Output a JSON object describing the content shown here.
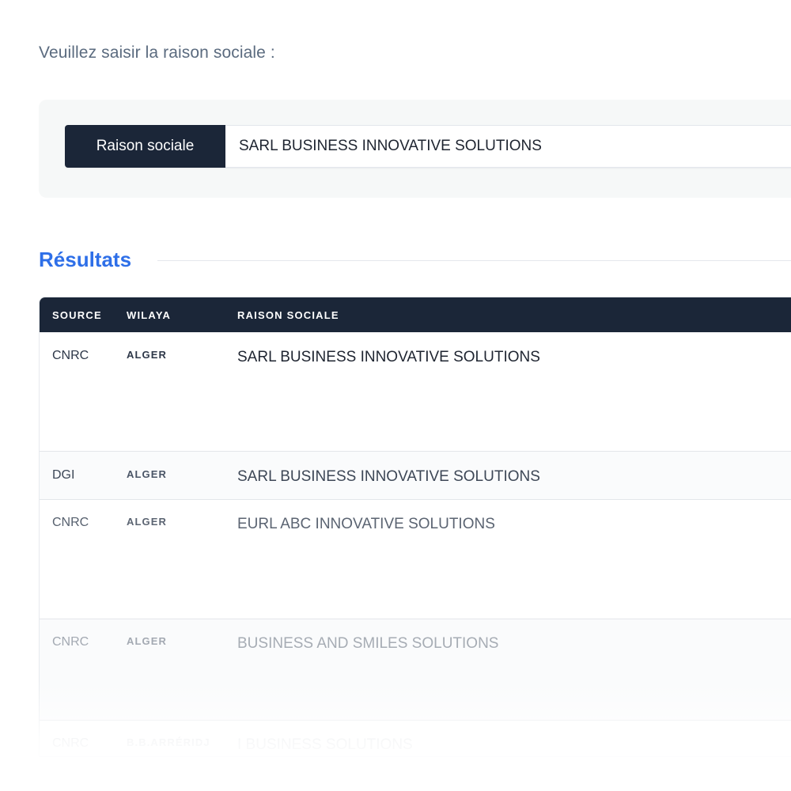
{
  "prompt": "Veuillez saisir la raison sociale :",
  "search": {
    "addon_label": "Raison sociale",
    "value": "SARL BUSINESS INNOVATIVE SOLUTIONS"
  },
  "results": {
    "title": "Résultats",
    "columns": [
      "SOURCE",
      "WILAYA",
      "RAISON SOCIALE"
    ],
    "rows": [
      {
        "source": "CNRC",
        "wilaya": "ALGER",
        "name": "SARL BUSINESS INNOVATIVE SOLUTIONS"
      },
      {
        "source": "DGI",
        "wilaya": "ALGER",
        "name": "SARL BUSINESS INNOVATIVE SOLUTIONS"
      },
      {
        "source": "CNRC",
        "wilaya": "ALGER",
        "name": "EURL ABC INNOVATIVE SOLUTIONS"
      },
      {
        "source": "CNRC",
        "wilaya": "ALGER",
        "name": "BUSINESS AND SMILES SOLUTIONS"
      },
      {
        "source": "CNRC",
        "wilaya": "B.B.ARRÉRIDJ",
        "name": "I BUSINESS SOLUTIONS"
      }
    ]
  },
  "colors": {
    "header_bg": "#1b2638",
    "accent": "#2e6fe8",
    "panel_bg": "#f6f8f8"
  }
}
